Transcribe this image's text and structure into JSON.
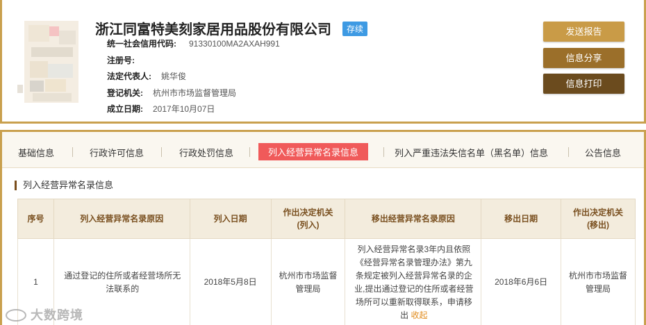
{
  "company": {
    "name": "浙江同富特美刻家居用品股份有限公司",
    "status": "存续"
  },
  "info": [
    {
      "label": "统一社会信用代码:",
      "value": "91330100MA2AXAH991"
    },
    {
      "label": "注册号:",
      "value": ""
    },
    {
      "label": "法定代表人:",
      "value": "姚华俊"
    },
    {
      "label": "登记机关:",
      "value": "杭州市市场监督管理局"
    },
    {
      "label": "成立日期:",
      "value": "2017年10月07日"
    }
  ],
  "actions": {
    "report": "发送报告",
    "share": "信息分享",
    "print": "信息打印"
  },
  "tabs": [
    {
      "label": "基础信息"
    },
    {
      "label": "行政许可信息"
    },
    {
      "label": "行政处罚信息"
    },
    {
      "label": "列入经营异常名录信息"
    },
    {
      "label": "列入严重违法失信名单（黑名单）信息"
    },
    {
      "label": "公告信息"
    }
  ],
  "active_tab_index": 3,
  "section_title": "列入经营异常名录信息",
  "table": {
    "headers": {
      "seq": "序号",
      "reason_in": "列入经营异常名录原因",
      "date_in": "列入日期",
      "authority_in_line1": "作出决定机关",
      "authority_in_line2": "(列入)",
      "reason_out": "移出经营异常名录原因",
      "date_out": "移出日期",
      "authority_out_line1": "作出决定机关",
      "authority_out_line2": "(移出)"
    },
    "rows": [
      {
        "seq": "1",
        "reason_in": "通过登记的住所或者经营场所无法联系的",
        "date_in": "2018年5月8日",
        "authority_in": "杭州市市场监督管理局",
        "reason_out": "列入经营异常名录3年内且依照《经营异常名录管理办法》第九条规定被列入经营异常名录的企业,提出通过登记的住所或者经营场所可以重新取得联系，申请移出",
        "fold_label": "收起",
        "date_out": "2018年6月6日",
        "authority_out": "杭州市市场监督管理局"
      }
    ]
  },
  "watermark": "大数跨境",
  "colors": {
    "gold_border": "#c9a04e",
    "status_badge": "#3e9ae3",
    "active_tab": "#f05a5a",
    "report_button": "#c99b47",
    "share_button": "#9b6f2a",
    "print_button": "#6b4b1e"
  }
}
